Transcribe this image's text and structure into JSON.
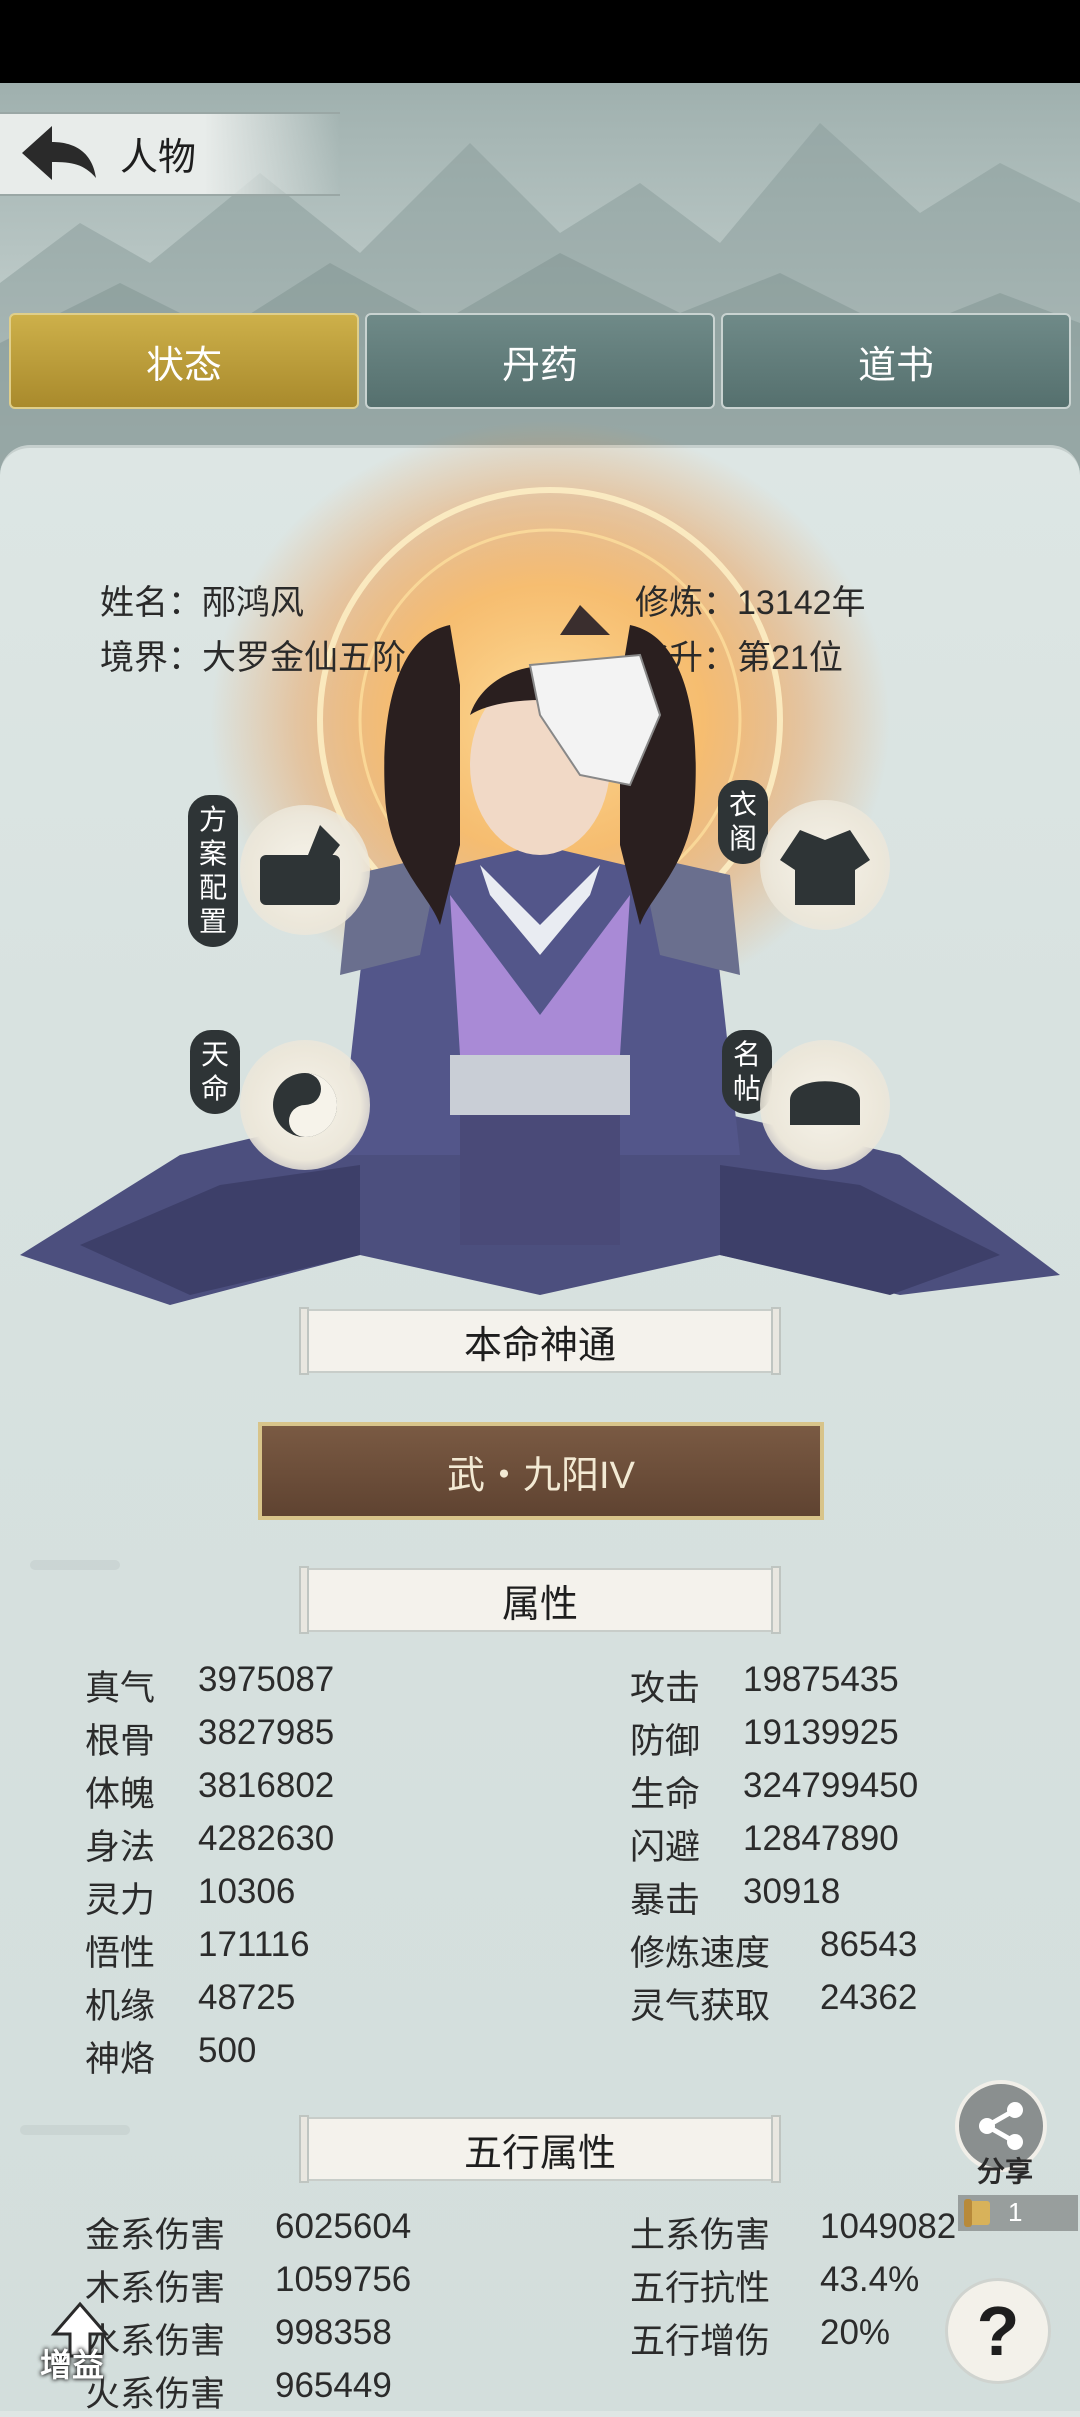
{
  "header": {
    "title": "人物"
  },
  "tabs": [
    {
      "label": "状态",
      "active": true
    },
    {
      "label": "丹药",
      "active": false
    },
    {
      "label": "道书",
      "active": false
    }
  ],
  "profile": {
    "name": "姓名：邴鸿风",
    "realm": "境界：大罗金仙五阶",
    "cultivation": "修炼：13142年",
    "ascension": "飞升：第21位"
  },
  "side_buttons": {
    "plan": "方案配置",
    "wardrobe": "衣阁",
    "fate": "天命",
    "card": "名帖"
  },
  "natal": {
    "title": "本命神通",
    "skill": "武・九阳IV"
  },
  "attributes": {
    "title": "属性",
    "left": [
      {
        "label": "真气",
        "value": "3975087"
      },
      {
        "label": "根骨",
        "value": "3827985"
      },
      {
        "label": "体魄",
        "value": "3816802"
      },
      {
        "label": "身法",
        "value": "4282630"
      },
      {
        "label": "灵力",
        "value": "10306"
      },
      {
        "label": "悟性",
        "value": "171116"
      },
      {
        "label": "机缘",
        "value": "48725"
      },
      {
        "label": "神烙",
        "value": "500"
      }
    ],
    "right": [
      {
        "label": "攻击",
        "value": "19875435"
      },
      {
        "label": "防御",
        "value": "19139925"
      },
      {
        "label": "生命",
        "value": "324799450"
      },
      {
        "label": "闪避",
        "value": "12847890"
      },
      {
        "label": "暴击",
        "value": "30918"
      },
      {
        "label": "修炼速度",
        "value": "86543"
      },
      {
        "label": "灵气获取",
        "value": "24362"
      }
    ]
  },
  "elements": {
    "title": "五行属性",
    "left": [
      {
        "label": "金系伤害",
        "value": "6025604"
      },
      {
        "label": "木系伤害",
        "value": "1059756"
      },
      {
        "label": "水系伤害",
        "value": "998358"
      },
      {
        "label": "火系伤害",
        "value": "965449"
      }
    ],
    "right": [
      {
        "label": "土系伤害",
        "value": "1049082"
      },
      {
        "label": "五行抗性",
        "value": "43.4%"
      },
      {
        "label": "五行增伤",
        "value": "20%"
      }
    ]
  },
  "floating": {
    "share": "分享",
    "scroll_count": "1",
    "help": "?",
    "boost": "增益"
  },
  "colors": {
    "tab_active": "#c4a43f",
    "tab_inactive": "#617c7a",
    "skill_plate": "#6b4d39"
  }
}
